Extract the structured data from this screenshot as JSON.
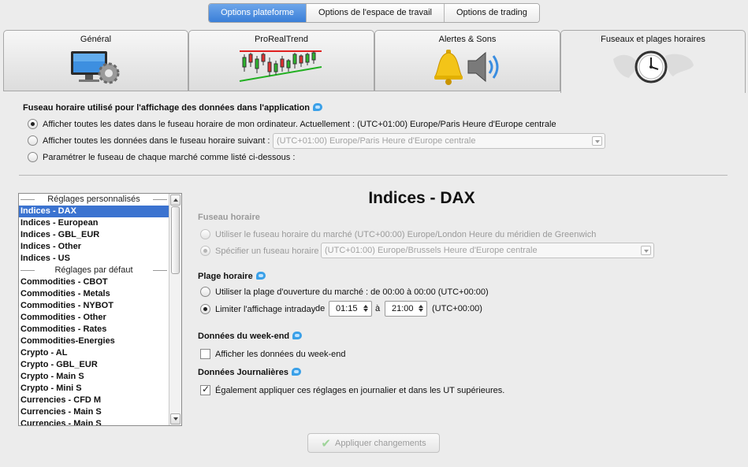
{
  "top_tabs": [
    {
      "label": "Options plateforme",
      "active": true
    },
    {
      "label": "Options de l'espace de travail",
      "active": false
    },
    {
      "label": "Options de trading",
      "active": false
    }
  ],
  "section_tabs": [
    {
      "label": "Général",
      "icon": "monitor-gear-icon"
    },
    {
      "label": "ProRealTrend",
      "icon": "trend-chart-icon"
    },
    {
      "label": "Alertes & Sons",
      "icon": "bell-speaker-icon"
    },
    {
      "label": "Fuseaux et plages horaires",
      "icon": "world-clock-icon",
      "active": true
    }
  ],
  "timezone": {
    "title": "Fuseau horaire utilisé pour l'affichage des données dans l'application",
    "option1": "Afficher toutes les dates dans le fuseau horaire de mon ordinateur. Actuellement : (UTC+01:00) Europe/Paris Heure d'Europe centrale",
    "option2": "Afficher toutes les données dans le fuseau horaire suivant :",
    "option2_combo": "(UTC+01:00) Europe/Paris Heure d'Europe centrale",
    "option3": "Paramétrer le fuseau de chaque marché comme listé ci-dessous :",
    "selected": 1
  },
  "market_list": {
    "group1": "Réglages personnalisés",
    "custom": [
      "Indices - DAX",
      "Indices - European",
      "Indices - GBL_EUR",
      "Indices - Other",
      "Indices - US"
    ],
    "group2": "Réglages par défaut",
    "defaults": [
      "Commodities - CBOT",
      "Commodities - Metals",
      "Commodities - NYBOT",
      "Commodities - Other",
      "Commodities - Rates",
      "Commodities-Energies",
      "Crypto - AL",
      "Crypto - GBL_EUR",
      "Crypto - Main S",
      "Crypto - Mini S",
      "Currencies - CFD M",
      "Currencies - Main S",
      "Currencies - Main S"
    ],
    "selected": "Indices - DAX"
  },
  "detail": {
    "market_title": "Indices - DAX",
    "fuseau_title": "Fuseau horaire",
    "fuseau_opt1": "Utiliser le fuseau horaire du marché (UTC+00:00) Europe/London Heure du méridien de Greenwich",
    "fuseau_opt2": "Spécifier un fuseau horaire :",
    "fuseau_combo": "(UTC+01:00) Europe/Brussels Heure d'Europe centrale",
    "plage_title": "Plage horaire",
    "plage_opt1": "Utiliser la plage d'ouverture du marché : de 00:00 à 00:00  (UTC+00:00)",
    "plage_opt2": "Limiter l'affichage intraday",
    "de_label": "de",
    "from_time": "01:15",
    "a_label": "à",
    "to_time": "21:00",
    "tz_suffix": "(UTC+00:00)",
    "weekend_title": "Données du week-end",
    "weekend_check": "Afficher les données du week-end",
    "weekend_checked": false,
    "daily_title": "Données Journalières",
    "daily_check": "Également appliquer ces réglages en journalier et dans les UT supérieures.",
    "daily_checked": true
  },
  "apply_label": "Appliquer changements",
  "colors": {
    "accent": "#3b73d0",
    "active_tab": "#4a8ee2",
    "info_bubble": "#3aa0e8"
  }
}
